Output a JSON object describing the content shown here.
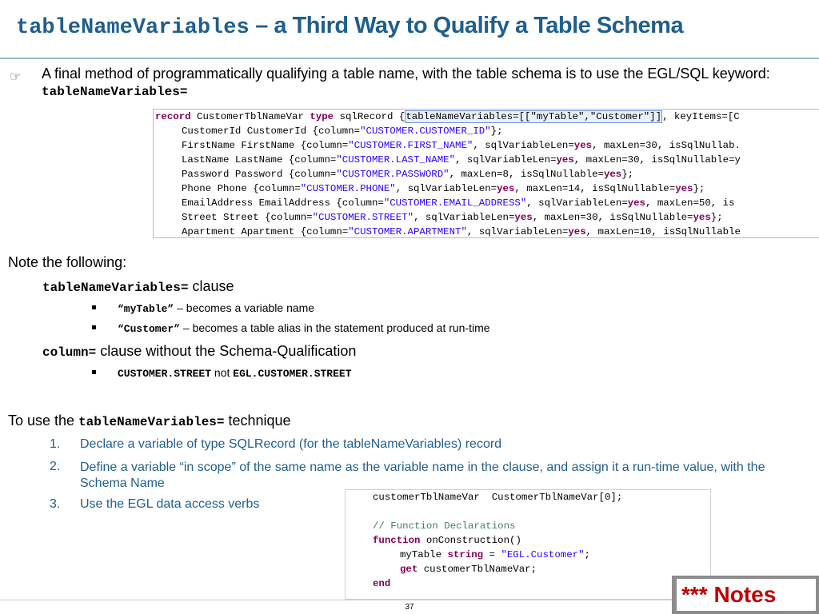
{
  "slide": {
    "title_code": "tableNameVariables",
    "title_rest": " – a Third Way to Qualify a Table Schema",
    "bullet1_text": "A final method of programmatically qualifying a table name, with the table schema is to use the EGL/SQL keyword: ",
    "bullet1_code": "tableNameVariables=",
    "note_heading": "Note the following:",
    "clause1_code": "tableNameVariables=",
    "clause1_text": " clause",
    "sub1_code": "“myTable”",
    "sub1_text": " – becomes a variable name",
    "sub2_code": "“Customer”",
    "sub2_text": " – becomes a table alias in the statement produced at run-time",
    "clause2_code": "column=",
    "clause2_text": " clause without the Schema-Qualification",
    "sub3_code1": "CUSTOMER.STREET",
    "sub3_not": " not ",
    "sub3_code2": "EGL.CUSTOMER.STREET",
    "touse_text": "To use the ",
    "touse_code": "tableNameVariables=",
    "touse_tail": " technique",
    "steps": [
      {
        "num": "1.",
        "text": "Declare a variable of type SQLRecord (for the tableNameVariables) record"
      },
      {
        "num": "2.",
        "text": "Define a variable “in scope” of the same name as the variable name in the clause, and assign it a run-time value, with the Schema Name"
      },
      {
        "num": "3.",
        "text": "Use the EGL data access verbs"
      }
    ],
    "page_number": "37",
    "notes_badge": "*** Notes"
  },
  "code_record": [
    [
      {
        "t": "record",
        "c": "kw"
      },
      {
        "t": " CustomerTblNameVar "
      },
      {
        "t": "type",
        "c": "kw"
      },
      {
        "t": " sqlRecord {"
      },
      {
        "t": "tableNameVariables=[[\"myTable\",\"Customer\"]]",
        "c": "hl"
      },
      {
        "t": ", keyItems=[C"
      }
    ],
    [
      {
        "t": "CustomerId CustomerId {column="
      },
      {
        "t": "\"CUSTOMER.CUSTOMER_ID\"",
        "c": "str"
      },
      {
        "t": "};"
      }
    ],
    [
      {
        "t": "FirstName FirstName {column="
      },
      {
        "t": "\"CUSTOMER.FIRST_NAME\"",
        "c": "str"
      },
      {
        "t": ", sqlVariableLen="
      },
      {
        "t": "yes",
        "c": "kw"
      },
      {
        "t": ", maxLen=30, isSqlNullab."
      }
    ],
    [
      {
        "t": "LastName LastName {column="
      },
      {
        "t": "\"CUSTOMER.LAST_NAME\"",
        "c": "str"
      },
      {
        "t": ", sqlVariableLen="
      },
      {
        "t": "yes",
        "c": "kw"
      },
      {
        "t": ", maxLen=30, isSqlNullable=y"
      }
    ],
    [
      {
        "t": "Password Password {column="
      },
      {
        "t": "\"CUSTOMER.PASSWORD\"",
        "c": "str"
      },
      {
        "t": ", maxLen=8, isSqlNullable="
      },
      {
        "t": "yes",
        "c": "kw"
      },
      {
        "t": "};"
      }
    ],
    [
      {
        "t": "Phone Phone {column="
      },
      {
        "t": "\"CUSTOMER.PHONE\"",
        "c": "str"
      },
      {
        "t": ", sqlVariableLen="
      },
      {
        "t": "yes",
        "c": "kw"
      },
      {
        "t": ", maxLen=14, isSqlNullable="
      },
      {
        "t": "yes",
        "c": "kw"
      },
      {
        "t": "};"
      }
    ],
    [
      {
        "t": "EmailAddress EmailAddress {column="
      },
      {
        "t": "\"CUSTOMER.EMAIL_ADDRESS\"",
        "c": "str"
      },
      {
        "t": ", sqlVariableLen="
      },
      {
        "t": "yes",
        "c": "kw"
      },
      {
        "t": ", maxLen=50, is"
      }
    ],
    [
      {
        "t": "Street Street {column="
      },
      {
        "t": "\"CUSTOMER.STREET\"",
        "c": "str"
      },
      {
        "t": ", sqlVariableLen="
      },
      {
        "t": "yes",
        "c": "kw"
      },
      {
        "t": ", maxLen=30, isSqlNullable="
      },
      {
        "t": "yes",
        "c": "kw"
      },
      {
        "t": "};"
      }
    ],
    [
      {
        "t": "Apartment Apartment {column="
      },
      {
        "t": "\"CUSTOMER.APARTMENT\"",
        "c": "str"
      },
      {
        "t": ", sqlVariableLen="
      },
      {
        "t": "yes",
        "c": "kw"
      },
      {
        "t": ", maxLen=10, isSqlNullable"
      }
    ]
  ],
  "code_function": [
    [
      {
        "t": "customerTblNameVar  CustomerTblNameVar[0];"
      }
    ],
    [],
    [
      {
        "t": "// Function Declarations",
        "c": "cmt"
      }
    ],
    [
      {
        "t": "function",
        "c": "kw"
      },
      {
        "t": " onConstruction()"
      }
    ],
    [
      {
        "t": "myTable "
      },
      {
        "t": "string",
        "c": "kw"
      },
      {
        "t": " = "
      },
      {
        "t": "\"EGL.Customer\"",
        "c": "str"
      },
      {
        "t": ";"
      }
    ],
    [
      {
        "t": "get",
        "c": "kw"
      },
      {
        "t": " customerTblNameVar;"
      }
    ],
    [
      {
        "t": "end",
        "c": "kw"
      }
    ]
  ]
}
